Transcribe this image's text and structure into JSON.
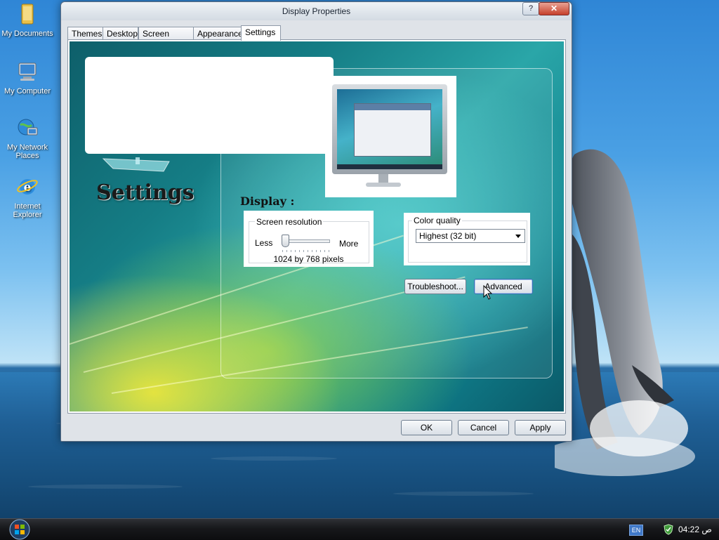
{
  "desktop": {
    "icons": [
      {
        "label": "My Documents",
        "icon": "folder-icon"
      },
      {
        "label": "My Computer",
        "icon": "computer-icon"
      },
      {
        "label": "My Network Places",
        "icon": "network-icon"
      },
      {
        "label": "Internet Explorer",
        "icon": "internet-explorer-icon"
      }
    ]
  },
  "window": {
    "title": "Display Properties",
    "help_label": "?",
    "close_label": "✕",
    "tabs": [
      {
        "label": "Themes"
      },
      {
        "label": "Desktop"
      },
      {
        "label": "Screen Saver"
      },
      {
        "label": "Appearance"
      },
      {
        "label": "Settings",
        "active": true
      }
    ],
    "panel": {
      "heading": "Settings",
      "display_label": "Display :",
      "screen_resolution": {
        "legend": "Screen resolution",
        "less": "Less",
        "more": "More",
        "value": "1024 by 768 pixels",
        "slider_fraction": 0.0
      },
      "color_quality": {
        "legend": "Color quality",
        "selected": "Highest (32 bit)"
      },
      "troubleshoot_label": "Troubleshoot...",
      "advanced_label": "Advanced"
    },
    "ok_label": "OK",
    "cancel_label": "Cancel",
    "apply_label": "Apply"
  },
  "taskbar": {
    "language": "EN",
    "clock": "04:22 ص"
  }
}
